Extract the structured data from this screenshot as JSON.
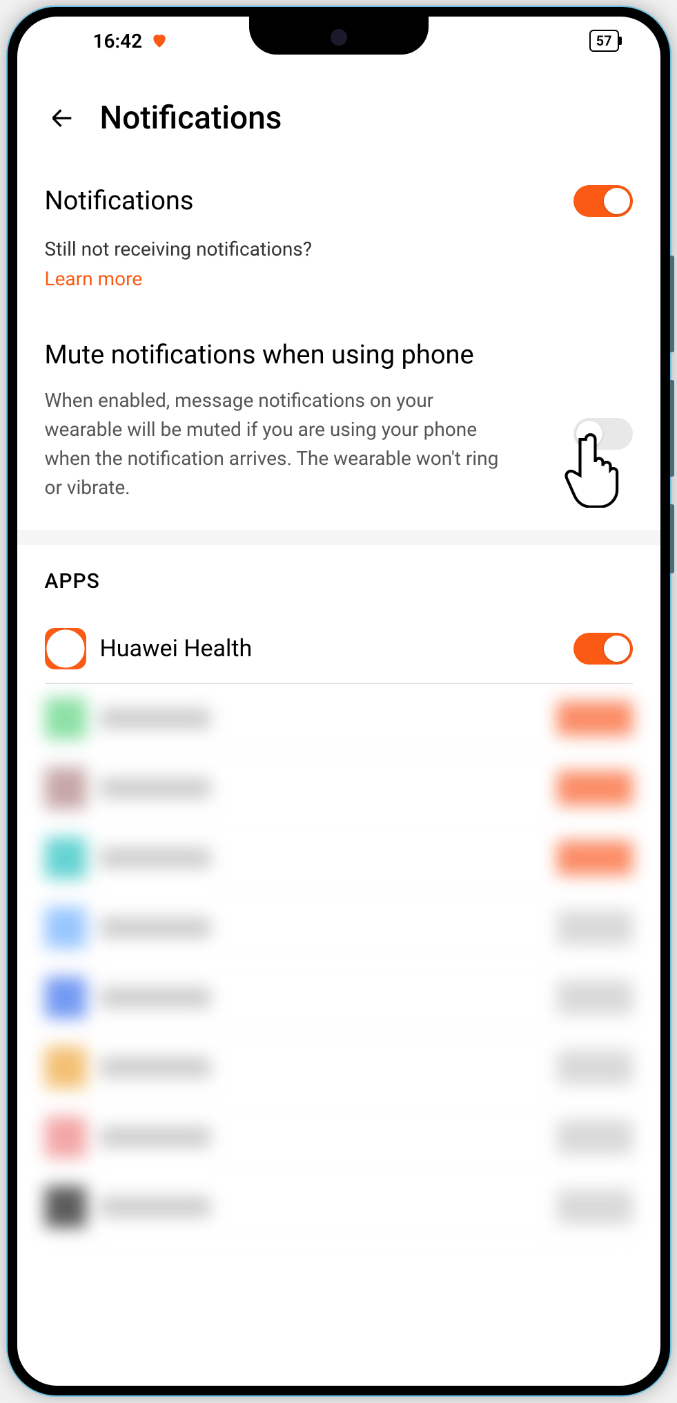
{
  "statusBar": {
    "time": "16:42",
    "battery": "57"
  },
  "header": {
    "title": "Notifications"
  },
  "notifications": {
    "title": "Notifications",
    "enabled": true,
    "helpText": "Still not receiving notifications?",
    "learnMore": "Learn more"
  },
  "mute": {
    "title": "Mute notifications when using phone",
    "description": "When enabled, message notifications on your wearable will be muted if you are using your phone when the notification arrives. The wearable won't ring or vibrate.",
    "enabled": false
  },
  "appsSection": {
    "header": "APPS",
    "apps": [
      {
        "name": "Huawei Health",
        "iconColor": "#fa5a14",
        "enabled": true,
        "blurred": false
      },
      {
        "name": "",
        "iconColor": "#6fd98f",
        "enabled": true,
        "blurred": true
      },
      {
        "name": "",
        "iconColor": "#b89090",
        "enabled": true,
        "blurred": true
      },
      {
        "name": "",
        "iconColor": "#3fc8c8",
        "enabled": true,
        "blurred": true
      },
      {
        "name": "",
        "iconColor": "#7fb8ff",
        "enabled": false,
        "blurred": true
      },
      {
        "name": "",
        "iconColor": "#5080f0",
        "enabled": false,
        "blurred": true
      },
      {
        "name": "",
        "iconColor": "#f0b050",
        "enabled": false,
        "blurred": true
      },
      {
        "name": "",
        "iconColor": "#f09090",
        "enabled": false,
        "blurred": true
      },
      {
        "name": "",
        "iconColor": "#333",
        "enabled": false,
        "blurred": true
      }
    ]
  },
  "colors": {
    "accent": "#fa5a14"
  }
}
